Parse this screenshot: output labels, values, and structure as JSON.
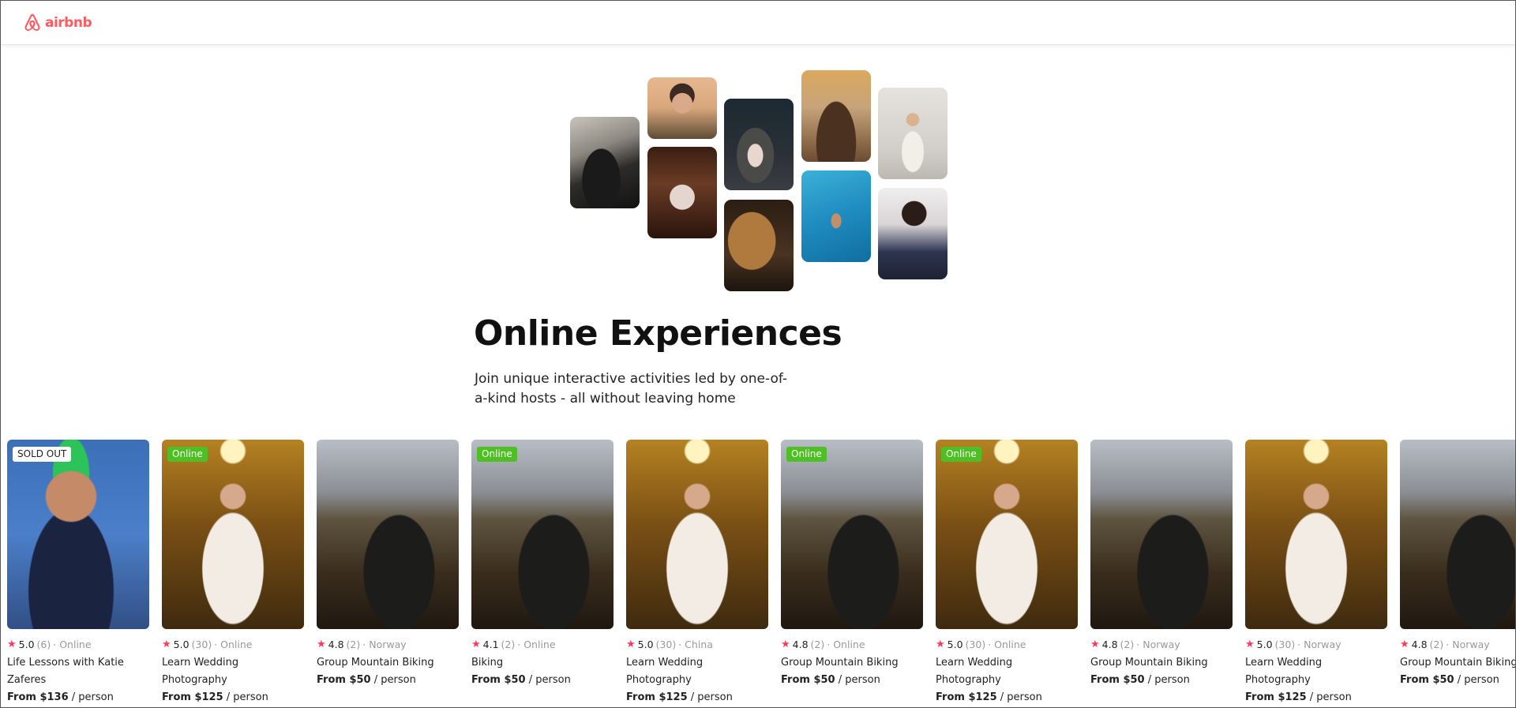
{
  "brand": {
    "name": "airbnb",
    "color": "#FF5A5F"
  },
  "collage": [
    {
      "name": "cooking-photo",
      "icon": "cooking",
      "ph": "ph-cook"
    },
    {
      "name": "host-woman-photo",
      "icon": "host",
      "ph": "ph-woman"
    },
    {
      "name": "ballet-photo",
      "icon": "dance",
      "ph": "ph-ball"
    },
    {
      "name": "bowl-food-photo",
      "icon": "food",
      "ph": "ph-bowl"
    },
    {
      "name": "guitar-photo",
      "icon": "guitar",
      "ph": "ph-guitar"
    },
    {
      "name": "microphone-photo",
      "icon": "microphone",
      "ph": "ph-mic"
    },
    {
      "name": "swimmer-photo",
      "icon": "swimming",
      "ph": "ph-swim"
    },
    {
      "name": "yoga-photo",
      "icon": "yoga",
      "ph": "ph-yoga"
    },
    {
      "name": "singer-photo",
      "icon": "singer",
      "ph": "ph-singer"
    }
  ],
  "hero": {
    "title": "Online Experiences",
    "subtitle": "Join unique interactive activities led by one-of-a-kind hosts - all without leaving home"
  },
  "cards": [
    {
      "badge": "SOLD OUT",
      "badge_type": "sold",
      "rating": "5.0",
      "count": "(6)",
      "location": "· Online",
      "title": "Life Lessons with Katie Zaferes",
      "price_prefix": "From ",
      "price": "$136",
      "price_suffix": " / person",
      "ph": "ph-athlete"
    },
    {
      "badge": "Online",
      "badge_type": "online",
      "rating": "5.0",
      "count": "(30)",
      "location": "· Online",
      "title": "Learn Wedding Photography",
      "price_prefix": "From ",
      "price": "$125",
      "price_suffix": " / person",
      "ph": "ph-bride"
    },
    {
      "badge": "",
      "badge_type": "",
      "rating": "4.8",
      "count": "(2)",
      "location": "· Norway",
      "title": "Group Mountain Biking",
      "price_prefix": "From ",
      "price": "$50",
      "price_suffix": " / person",
      "ph": "ph-bike"
    },
    {
      "badge": "Online",
      "badge_type": "online",
      "rating": "4.1",
      "count": "(2)",
      "location": "· Online",
      "title": "Biking",
      "price_prefix": "From ",
      "price": "$50",
      "price_suffix": " / person",
      "ph": "ph-bike"
    },
    {
      "badge": "",
      "badge_type": "",
      "rating": "5.0",
      "count": "(30)",
      "location": "· China",
      "title": "Learn Wedding Photography",
      "price_prefix": "From ",
      "price": "$125",
      "price_suffix": " / person",
      "ph": "ph-bride"
    },
    {
      "badge": "Online",
      "badge_type": "online",
      "rating": "4.8",
      "count": "(2)",
      "location": "· Online",
      "title": "Group Mountain Biking",
      "price_prefix": "From ",
      "price": "$50",
      "price_suffix": " / person",
      "ph": "ph-bike"
    },
    {
      "badge": "Online",
      "badge_type": "online",
      "rating": "5.0",
      "count": "(30)",
      "location": "· Online",
      "title": "Learn Wedding Photography",
      "price_prefix": "From ",
      "price": "$125",
      "price_suffix": " / person",
      "ph": "ph-bride"
    },
    {
      "badge": "",
      "badge_type": "",
      "rating": "4.8",
      "count": "(2)",
      "location": "· Norway",
      "title": "Group Mountain Biking",
      "price_prefix": "From ",
      "price": "$50",
      "price_suffix": " / person",
      "ph": "ph-bike"
    },
    {
      "badge": "",
      "badge_type": "",
      "rating": "5.0",
      "count": "(30)",
      "location": "· Norway",
      "title": "Learn Wedding Photography",
      "price_prefix": "From ",
      "price": "$125",
      "price_suffix": " / person",
      "ph": "ph-bride"
    },
    {
      "badge": "",
      "badge_type": "",
      "rating": "4.8",
      "count": "(2)",
      "location": "· Norway",
      "title": "Group Mountain Biking",
      "price_prefix": "From ",
      "price": "$50",
      "price_suffix": " / person",
      "ph": "ph-bike"
    }
  ]
}
